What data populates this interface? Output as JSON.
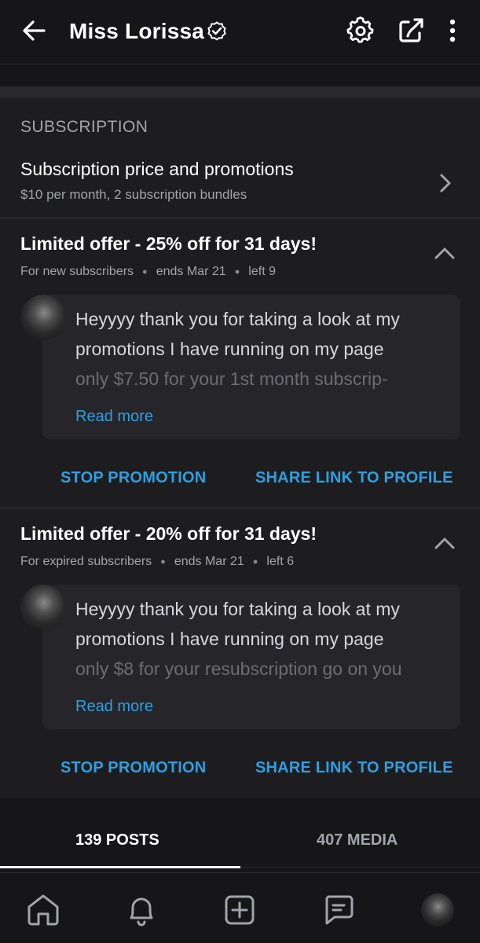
{
  "header": {
    "title": "Miss Lorissa",
    "icons": [
      "back-arrow-icon",
      "verified-badge-icon",
      "settings-gear-icon",
      "share-icon",
      "more-vert-icon"
    ]
  },
  "subscription": {
    "section_label": "SUBSCRIPTION",
    "row_title": "Subscription price and promotions",
    "row_desc": "$10 per month, 2 subscription bundles"
  },
  "offers": [
    {
      "title": "Limited offer - 25% off for 31 days!",
      "audience": "For new subscribers",
      "ends": "ends Mar 21",
      "left": "left 9",
      "message_lines": [
        "Heyyyy thank you for taking a look at my",
        "promotions I have running on my page",
        "only $7.50 for your 1st month subscrip-"
      ],
      "read_more": "Read more",
      "stop_label": "STOP PROMOTION",
      "share_label": "SHARE LINK TO PROFILE"
    },
    {
      "title": "Limited offer - 20% off for 31 days!",
      "audience": "For expired subscribers",
      "ends": "ends Mar 21",
      "left": "left 6",
      "message_lines": [
        "Heyyyy thank you for taking a look at my",
        "promotions I have running on my page",
        "only $8 for your resubscription go on you"
      ],
      "read_more": "Read more",
      "stop_label": "STOP PROMOTION",
      "share_label": "SHARE LINK TO PROFILE"
    }
  ],
  "tabs": {
    "posts": "139 POSTS",
    "media": "407 MEDIA",
    "active": "posts"
  },
  "bottom_nav": {
    "icons": [
      "home-icon",
      "bell-icon",
      "add-post-icon",
      "messages-icon",
      "profile-avatar"
    ]
  },
  "colors": {
    "background": "#161618",
    "panel": "#1d1d20",
    "accent": "#2f9fe0",
    "muted_text": "#a3a3ad"
  }
}
